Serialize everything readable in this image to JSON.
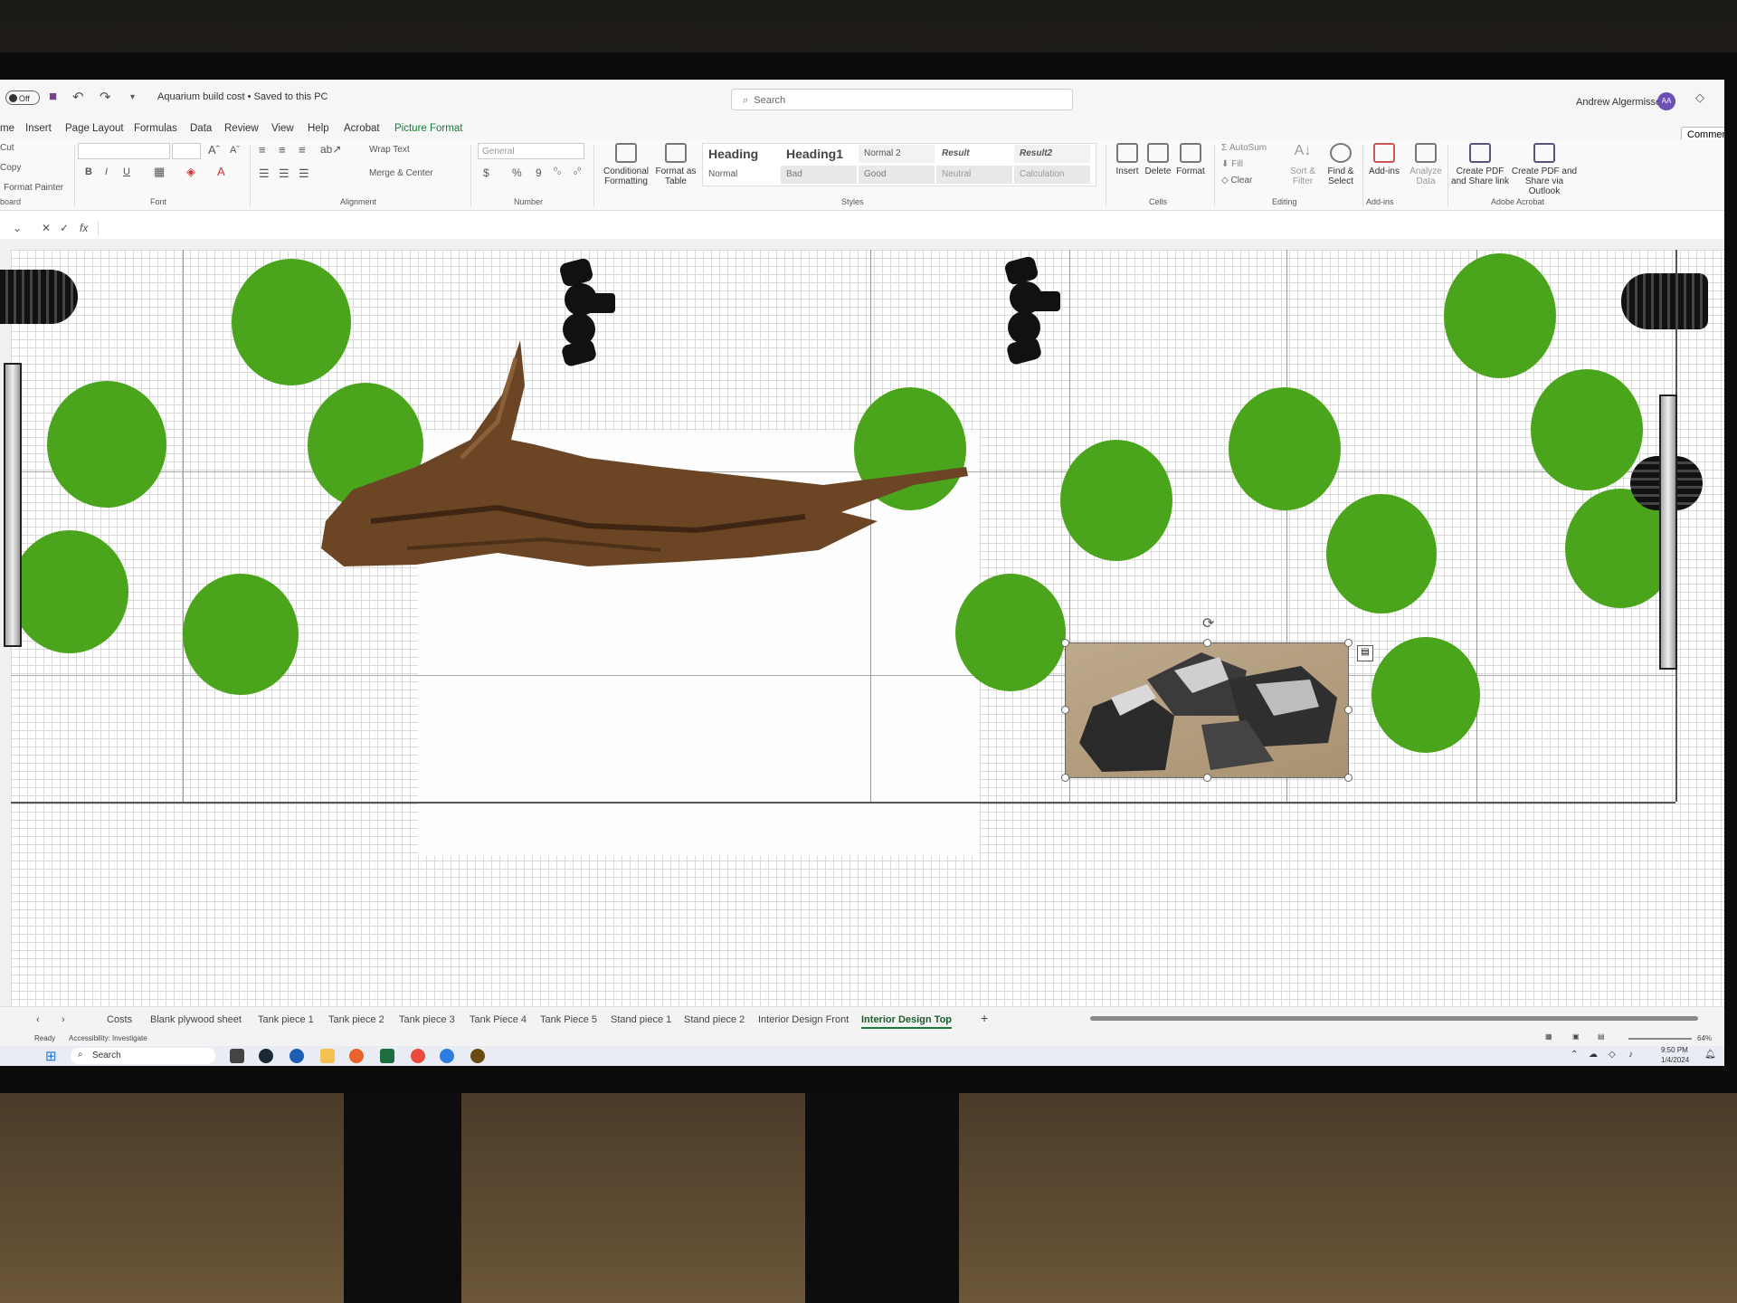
{
  "titlebar": {
    "autosave_label": "Off",
    "doc_title": "Aquarium build cost • Saved to this PC",
    "search_placeholder": "Search",
    "user_name": "Andrew Algermissen",
    "user_initials": "AA"
  },
  "menu": [
    "me",
    "Insert",
    "Page Layout",
    "Formulas",
    "Data",
    "Review",
    "View",
    "Help",
    "Acrobat",
    "Picture Format"
  ],
  "comments_label": "Comments",
  "ribbon": {
    "clipboard": {
      "cut": "Cut",
      "copy": "Copy",
      "format_painter": "Format Painter",
      "group": "board"
    },
    "font": {
      "group": "Font",
      "bold": "B",
      "italic": "I",
      "underline": "U"
    },
    "alignment": {
      "wrap_text": "Wrap Text",
      "merge_center": "Merge & Center",
      "group": "Alignment"
    },
    "number": {
      "format": "General",
      "currency": "$",
      "percent": "%",
      "comma": "9",
      "group": "Number"
    },
    "conditional_formatting": "Conditional Formatting",
    "format_as_table": "Format as Table",
    "styles": {
      "row1": [
        "Heading",
        "Heading1",
        "Normal 2",
        "Result",
        "Result2"
      ],
      "row2": [
        "Normal",
        "Bad",
        "Good",
        "Neutral",
        "Calculation"
      ],
      "group": "Styles"
    },
    "cells": {
      "insert": "Insert",
      "delete": "Delete",
      "format": "Format",
      "group": "Cells"
    },
    "editing": {
      "autosum": "AutoSum",
      "fill": "Fill",
      "clear": "Clear",
      "sort_filter": "Sort & Filter",
      "find_select": "Find & Select",
      "group": "Editing"
    },
    "addins": {
      "addins": "Add-ins",
      "analyze": "Analyze Data",
      "group": "Add-ins"
    },
    "acrobat": {
      "create_pdf_link": "Create PDF and Share link",
      "create_pdf_outlook": "Create PDF and Share via Outlook",
      "group": "Adobe Acrobat"
    }
  },
  "formula_bar": {
    "fx": "fx"
  },
  "sheet_tabs": [
    "Costs",
    "Blank plywood sheet",
    "Tank piece 1",
    "Tank piece 2",
    "Tank piece 3",
    "Tank Piece 4",
    "Tank Piece 5",
    "Stand piece 1",
    "Stand piece 2",
    "Interior Design Front",
    "Interior Design Top"
  ],
  "active_sheet": "Interior Design Top",
  "add_sheet": "+",
  "status": {
    "ready": "Ready",
    "accessibility": "Accessibility: Investigate",
    "zoom": "64%"
  },
  "taskbar": {
    "search_placeholder": "Search",
    "time": "9:50 PM",
    "date": "1/4/2024"
  },
  "colors": {
    "plant_green": "#4ba51c",
    "excel_green": "#1a7a3a"
  }
}
